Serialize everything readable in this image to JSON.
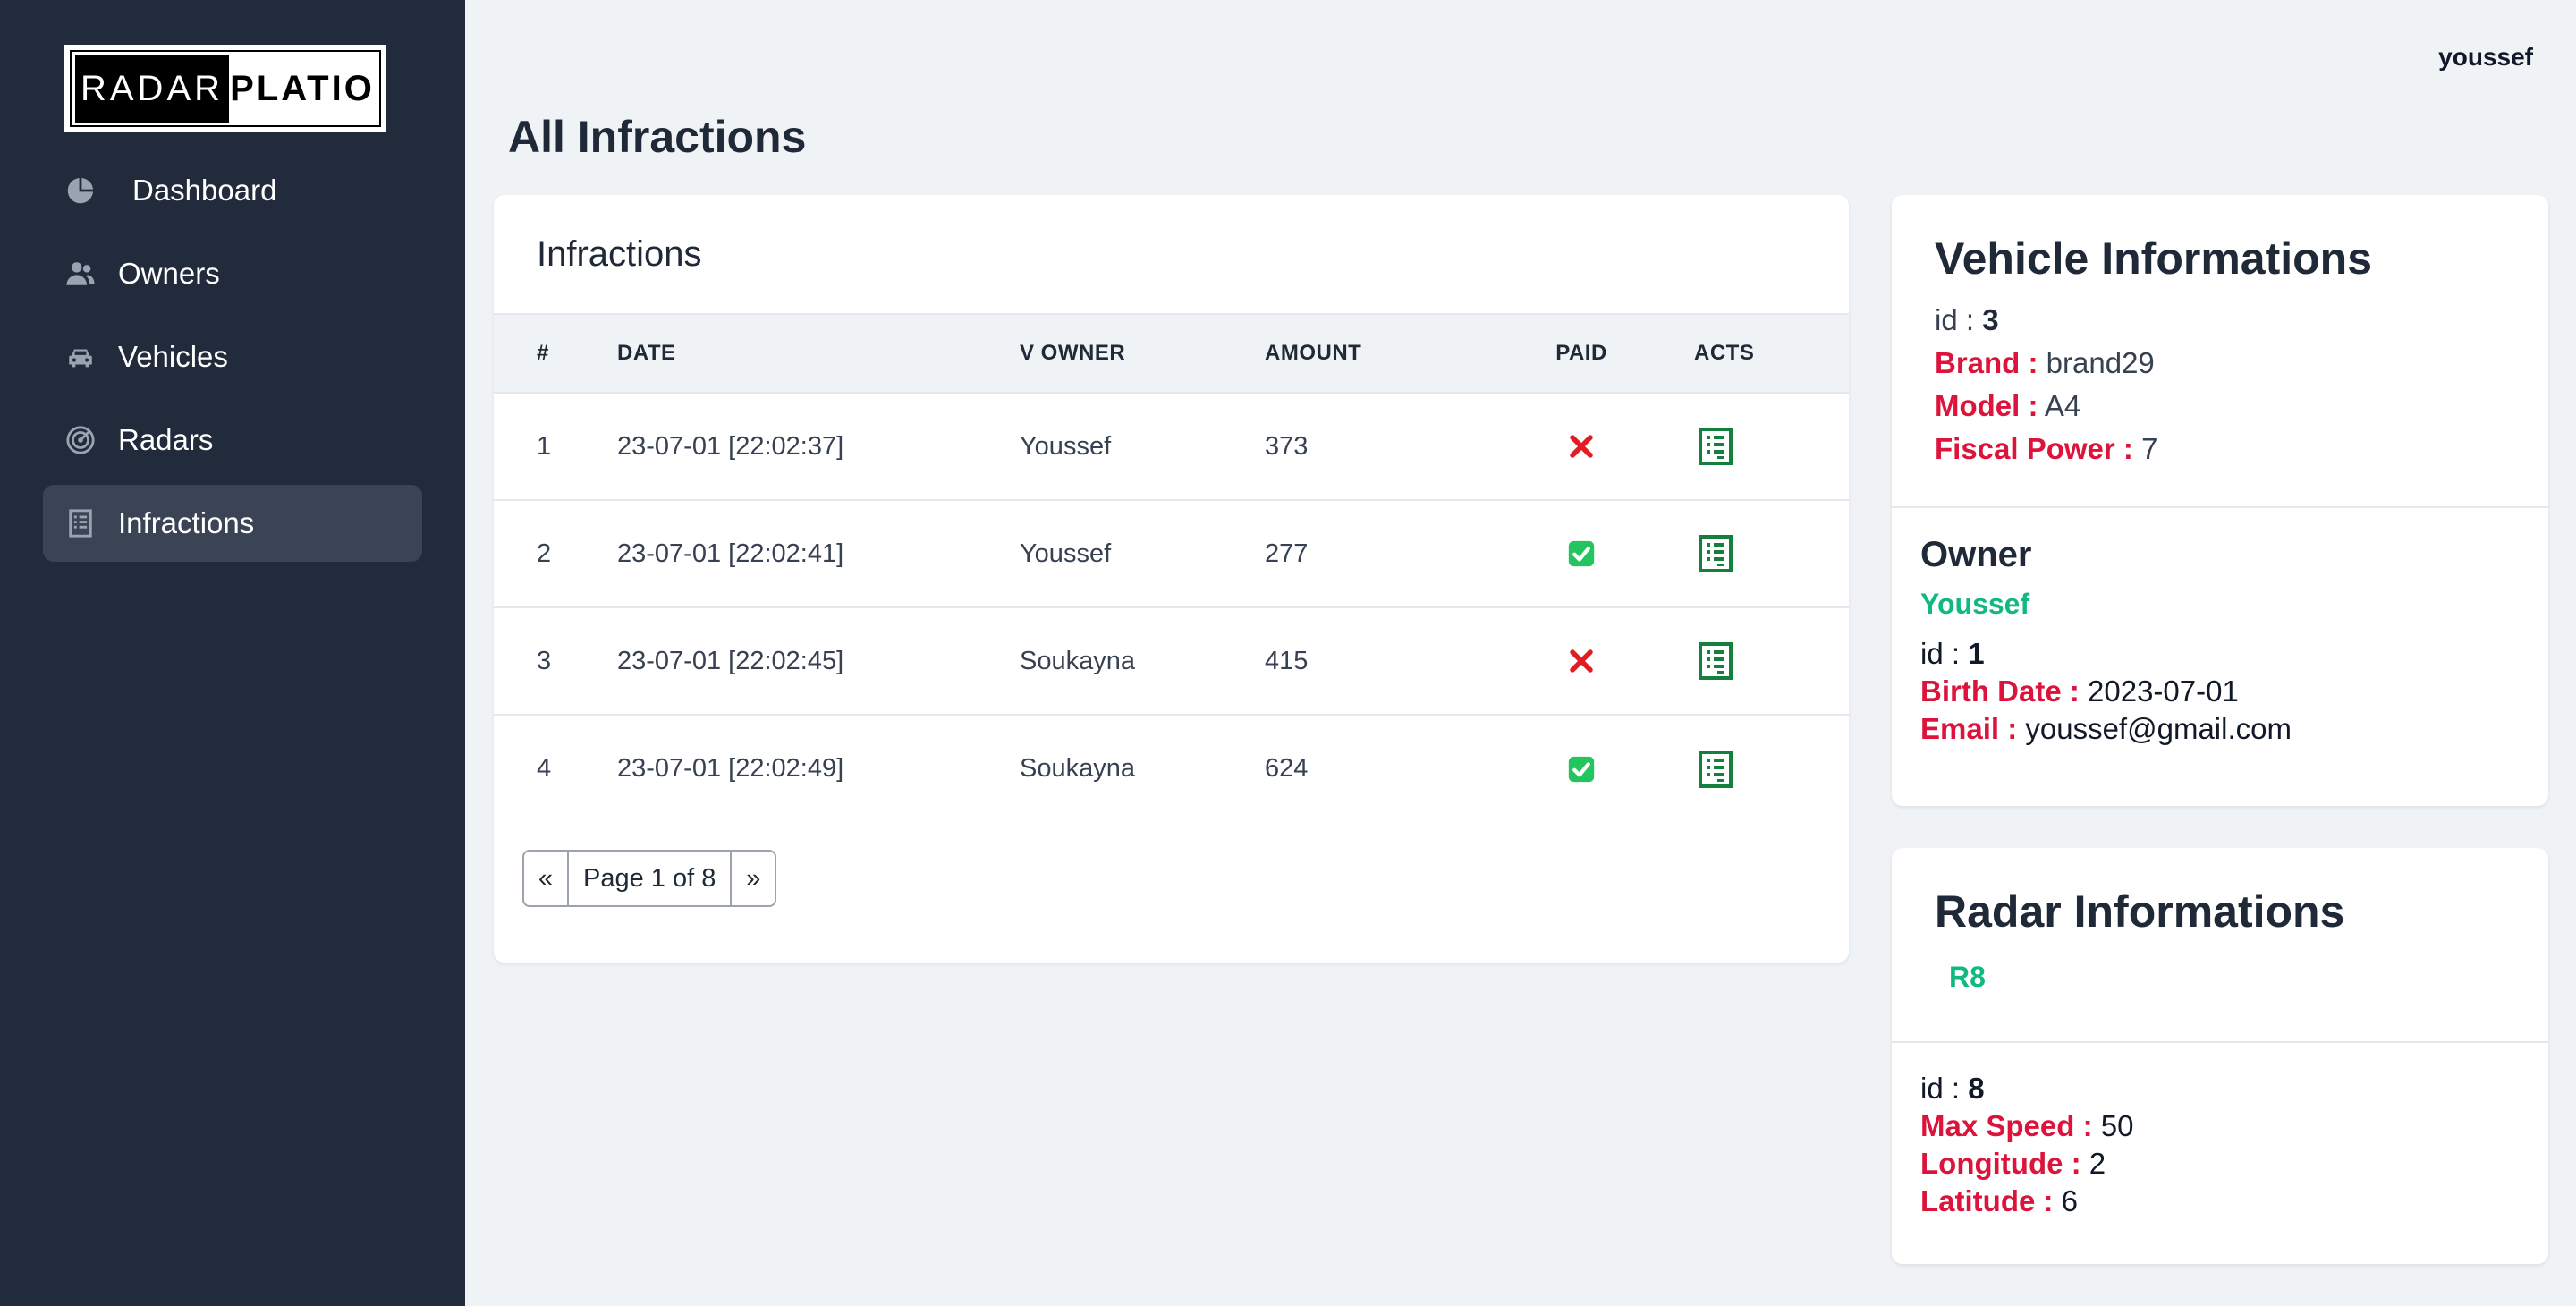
{
  "logo": {
    "left": "RADAR",
    "right": "PLATIO"
  },
  "user": "youssef",
  "sidebar": {
    "items": [
      {
        "label": "Dashboard",
        "icon": "pie-chart-icon"
      },
      {
        "label": "Owners",
        "icon": "users-icon"
      },
      {
        "label": "Vehicles",
        "icon": "car-icon"
      },
      {
        "label": "Radars",
        "icon": "radar-icon"
      },
      {
        "label": "Infractions",
        "icon": "receipt-icon",
        "active": true
      }
    ]
  },
  "page_title": "All Infractions",
  "infractions": {
    "title": "Infractions",
    "columns": [
      "#",
      "DATE",
      "V OWNER",
      "AMOUNT",
      "PAID",
      "ACTS"
    ],
    "rows": [
      {
        "num": "1",
        "date": "23-07-01 [22:02:37]",
        "owner": "Youssef",
        "amount": "373",
        "paid": false
      },
      {
        "num": "2",
        "date": "23-07-01 [22:02:41]",
        "owner": "Youssef",
        "amount": "277",
        "paid": true
      },
      {
        "num": "3",
        "date": "23-07-01 [22:02:45]",
        "owner": "Soukayna",
        "amount": "415",
        "paid": false
      },
      {
        "num": "4",
        "date": "23-07-01 [22:02:49]",
        "owner": "Soukayna",
        "amount": "624",
        "paid": true
      }
    ],
    "pager": {
      "prev": "«",
      "label": "Page 1 of 8",
      "next": "»"
    }
  },
  "vehicle": {
    "title": "Vehicle Informations",
    "id_label": "id :",
    "id": "3",
    "brand_label": "Brand :",
    "brand": "brand29",
    "model_label": "Model :",
    "model": "A4",
    "fiscal_label": "Fiscal Power :",
    "fiscal": "7"
  },
  "owner": {
    "title": "Owner",
    "name": "Youssef",
    "id_label": "id :",
    "id": "1",
    "birth_label": "Birth Date :",
    "birth": "2023-07-01",
    "email_label": "Email :",
    "email": "youssef@gmail.com"
  },
  "radar": {
    "title": "Radar Informations",
    "name": "R8",
    "id_label": "id :",
    "id": "8",
    "speed_label": "Max Speed :",
    "speed": "50",
    "lon_label": "Longitude :",
    "lon": "2",
    "lat_label": "Latitude :",
    "lat": "6"
  },
  "colors": {
    "sidebar_bg": "#222b3b",
    "active_item": "#3a4455",
    "label_red": "#dc143c",
    "accent_green": "#10b981",
    "paid_green": "#22c55e",
    "unpaid_red": "#e11d24",
    "act_green": "#15803d"
  }
}
